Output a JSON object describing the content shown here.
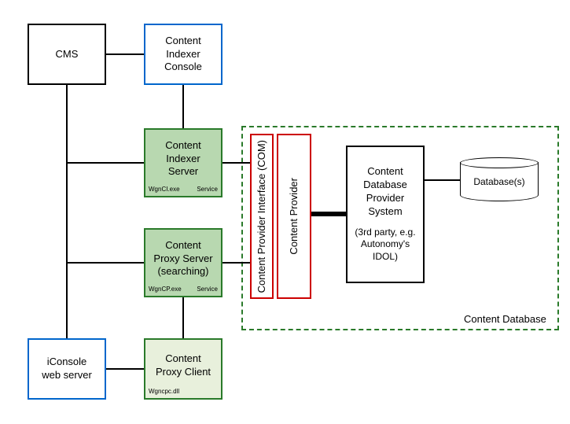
{
  "boxes": {
    "cms": "CMS",
    "indexer_console": "Content\nIndexer\nConsole",
    "indexer_server": "Content\nIndexer\nServer",
    "indexer_server_exe": "WgnCI.exe",
    "indexer_server_type": "Service",
    "proxy_server": "Content\nProxy Server\n(searching)",
    "proxy_server_exe": "WgnCP.exe",
    "proxy_server_type": "Service",
    "iconsole": "iConsole\nweb server",
    "proxy_client": "Content\nProxy Client",
    "proxy_client_dll": "Wgncpc.dll",
    "cpi": "Content Provider Interface (COM)",
    "content_provider": "Content Provider",
    "cdps": "Content\nDatabase\nProvider\nSystem",
    "cdps_sub": "(3rd party, e.g.\nAutonomy's\nIDOL)",
    "database": "Database(s)",
    "content_db": "Content Database"
  }
}
